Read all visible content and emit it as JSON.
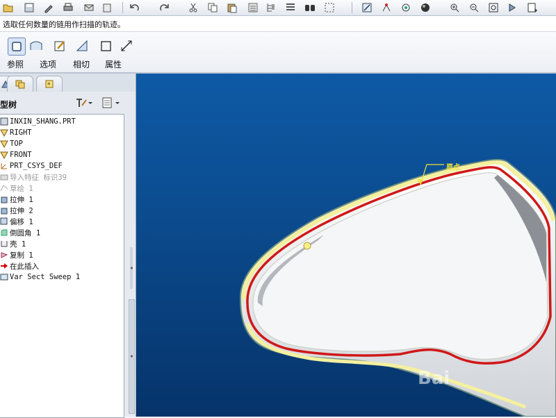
{
  "toolbar": {
    "icons": [
      "open-icon",
      "save-icon",
      "edit-icon",
      "print-icon",
      "email-icon",
      "undo-icon",
      "redo-icon",
      "cut-icon",
      "copy-icon",
      "paste-icon",
      "regenerate-icon",
      "model-tree-icon",
      "find-icon",
      "select-box-icon",
      "sketch-icon",
      "datum-point-icon",
      "spin-icon",
      "shading-icon",
      "zoom-in-icon",
      "zoom-out-icon",
      "refit-icon",
      "orient-icon",
      "view-list-icon"
    ]
  },
  "message": "选取任何数量的链用作扫描的轨迹。",
  "dashboard": {
    "tabs": [
      "参照",
      "选项",
      "相切",
      "属性"
    ],
    "icons": [
      "sweep-solid-icon",
      "sweep-surface-icon",
      "edit-section-icon",
      "remove-material-icon",
      "thin-icon",
      "flip-icon"
    ]
  },
  "left_panel": {
    "tree_title": "型树",
    "tree_items": [
      {
        "label": "INXIN_SHANG.PRT",
        "icon": "part-icon",
        "dim": false
      },
      {
        "label": "RIGHT",
        "icon": "datum-plane-icon",
        "dim": false
      },
      {
        "label": "TOP",
        "icon": "datum-plane-icon",
        "dim": false
      },
      {
        "label": "FRONT",
        "icon": "datum-plane-icon",
        "dim": false
      },
      {
        "label": "PRT_CSYS_DEF",
        "icon": "csys-icon",
        "dim": false
      },
      {
        "label": "导入特征 标识39",
        "icon": "import-icon",
        "dim": true
      },
      {
        "label": "草绘 1",
        "icon": "sketch-icon",
        "dim": true
      },
      {
        "label": "拉伸 1",
        "icon": "extrude-icon",
        "dim": false
      },
      {
        "label": "拉伸 2",
        "icon": "extrude-icon",
        "dim": false
      },
      {
        "label": "偏移 1",
        "icon": "offset-icon",
        "dim": false
      },
      {
        "label": "倒圆角 1",
        "icon": "round-icon",
        "dim": false
      },
      {
        "label": "壳 1",
        "icon": "shell-icon",
        "dim": false
      },
      {
        "label": "复制 1",
        "icon": "copy-feature-icon",
        "dim": false
      },
      {
        "label": "在此插入",
        "icon": "insert-here-icon",
        "dim": false
      },
      {
        "label": "Var Sect Sweep 1",
        "icon": "sweep-feature-icon",
        "dim": false
      }
    ]
  },
  "viewport": {
    "datum_label": "原点",
    "watermark": "Bai",
    "colors": {
      "bg_top": "#0e5aa6",
      "bg_bottom": "#06336a",
      "trajectory": "#d01818",
      "highlight": "#f4f0a0"
    }
  }
}
